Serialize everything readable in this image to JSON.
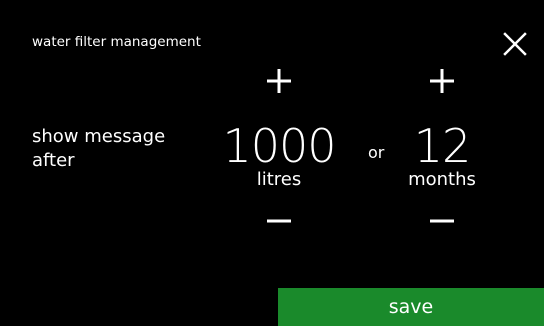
{
  "header": {
    "title": "water filter management",
    "close_icon": "close-icon"
  },
  "setting": {
    "label": "show message after",
    "connector": "or"
  },
  "volume": {
    "value": "1000",
    "unit": "litres",
    "increment_icon": "plus-icon",
    "decrement_icon": "minus-icon"
  },
  "time": {
    "value": "12",
    "unit": "months",
    "increment_icon": "plus-icon",
    "decrement_icon": "minus-icon"
  },
  "footer": {
    "save_label": "save"
  },
  "colors": {
    "background": "#000000",
    "text": "#ffffff",
    "save_button": "#1a8a2b"
  }
}
